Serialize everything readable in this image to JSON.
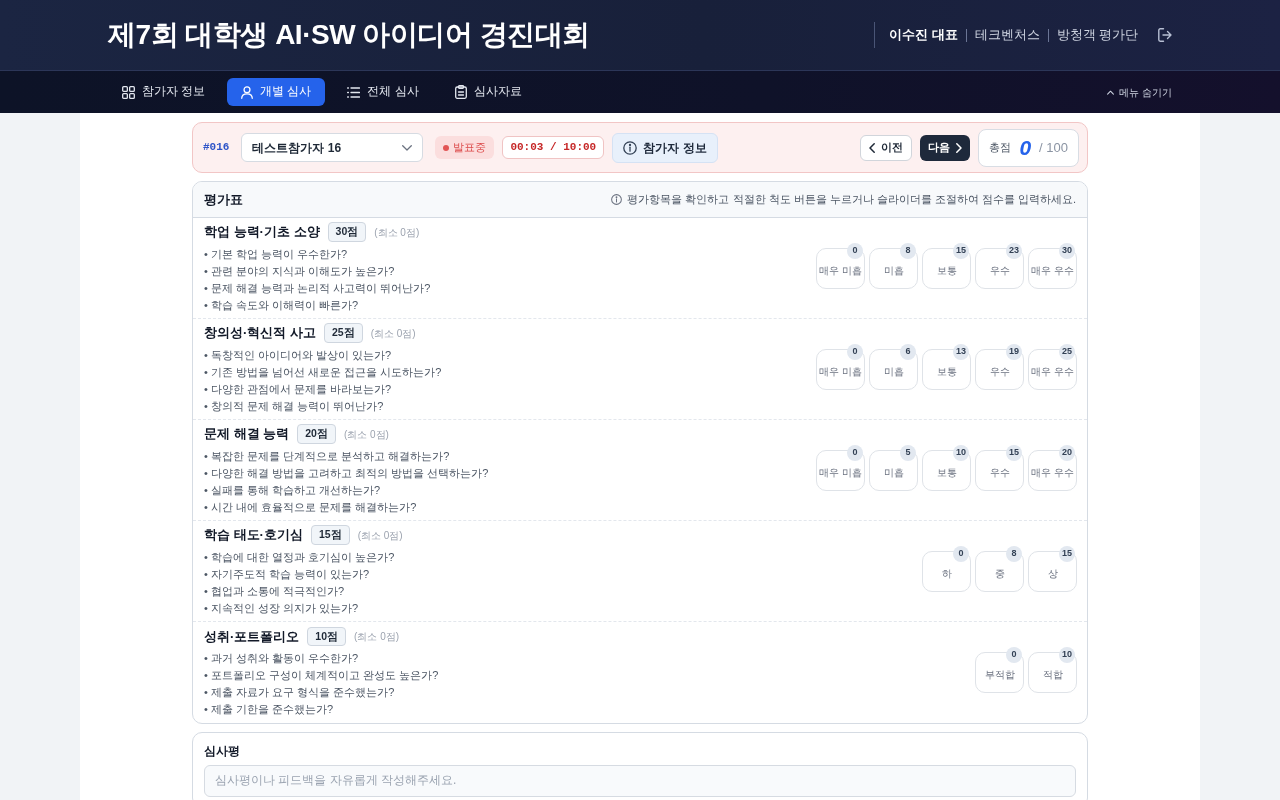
{
  "header": {
    "title": "제7회 대학생 AI·SW 아이디어 경진대회",
    "user": {
      "name": "이수진 대표",
      "company": "테크벤처스",
      "role": "방청객 평가단"
    }
  },
  "nav": {
    "tabs": [
      {
        "label": "참가자 정보",
        "selected": false
      },
      {
        "label": "개별 심사",
        "selected": true
      },
      {
        "label": "전체 심사",
        "selected": false
      },
      {
        "label": "심사자료",
        "selected": false
      }
    ],
    "toggle": "메뉴 숨기기"
  },
  "participant": {
    "number": "#016",
    "name": "테스트참가자 16",
    "status": {
      "kind": "live",
      "label": "발표중"
    },
    "timer": "00:03 / 10:00",
    "info_button": "참가자 정보",
    "prev": "이전",
    "next": "다음",
    "total": {
      "label": "총점",
      "score": "0",
      "max": "/ 100"
    }
  },
  "evaluation": {
    "title": "평가표",
    "hint": "평가항목을 확인하고 적절한 척도 버튼을 누르거나 슬라이더를 조절하여 점수를 입력하세요.",
    "criteria": [
      {
        "title": "학업 능력·기초 소양",
        "points": "30점",
        "minimum": "(최소 0점)",
        "questions": [
          "• 기본 학업 능력이 우수한가?",
          "• 관련 분야의 지식과 이해도가 높은가?",
          "• 문제 해결 능력과 논리적 사고력이 뛰어난가?",
          "• 학습 속도와 이해력이 빠른가?"
        ],
        "options": [
          {
            "label": "매우 미흡",
            "value": "0",
            "selected": false
          },
          {
            "label": "미흡",
            "value": "8",
            "selected": false
          },
          {
            "label": "보통",
            "value": "15",
            "selected": false
          },
          {
            "label": "우수",
            "value": "23",
            "selected": false
          },
          {
            "label": "매우 우수",
            "value": "30",
            "selected": false
          }
        ]
      },
      {
        "title": "창의성·혁신적 사고",
        "points": "25점",
        "minimum": "(최소 0점)",
        "questions": [
          "• 독창적인 아이디어와 발상이 있는가?",
          "• 기존 방법을 넘어선 새로운 접근을 시도하는가?",
          "• 다양한 관점에서 문제를 바라보는가?",
          "• 창의적 문제 해결 능력이 뛰어난가?"
        ],
        "options": [
          {
            "label": "매우 미흡",
            "value": "0",
            "selected": false
          },
          {
            "label": "미흡",
            "value": "6",
            "selected": false
          },
          {
            "label": "보통",
            "value": "13",
            "selected": false
          },
          {
            "label": "우수",
            "value": "19",
            "selected": false
          },
          {
            "label": "매우 우수",
            "value": "25",
            "selected": false
          }
        ]
      },
      {
        "title": "문제 해결 능력",
        "points": "20점",
        "minimum": "(최소 0점)",
        "questions": [
          "• 복잡한 문제를 단계적으로 분석하고 해결하는가?",
          "• 다양한 해결 방법을 고려하고 최적의 방법을 선택하는가?",
          "• 실패를 통해 학습하고 개선하는가?",
          "• 시간 내에 효율적으로 문제를 해결하는가?"
        ],
        "options": [
          {
            "label": "매우 미흡",
            "value": "0",
            "selected": false
          },
          {
            "label": "미흡",
            "value": "5",
            "selected": false
          },
          {
            "label": "보통",
            "value": "10",
            "selected": false
          },
          {
            "label": "우수",
            "value": "15",
            "selected": false
          },
          {
            "label": "매우 우수",
            "value": "20",
            "selected": false
          }
        ]
      },
      {
        "title": "학습 태도·호기심",
        "points": "15점",
        "minimum": "(최소 0점)",
        "questions": [
          "• 학습에 대한 열정과 호기심이 높은가?",
          "• 자기주도적 학습 능력이 있는가?",
          "• 협업과 소통에 적극적인가?",
          "• 지속적인 성장 의지가 있는가?"
        ],
        "options": [
          {
            "label": "하",
            "value": "0",
            "selected": false
          },
          {
            "label": "중",
            "value": "8",
            "selected": false
          },
          {
            "label": "상",
            "value": "15",
            "selected": false
          }
        ]
      },
      {
        "title": "성취·포트폴리오",
        "points": "10점",
        "minimum": "(최소 0점)",
        "questions": [
          "• 과거 성취와 활동이 우수한가?",
          "• 포트폴리오 구성이 체계적이고 완성도 높은가?",
          "• 제출 자료가 요구 형식을 준수했는가?",
          "• 제출 기한을 준수했는가?"
        ],
        "options": [
          {
            "label": "부적합",
            "value": "0",
            "selected": false
          },
          {
            "label": "적합",
            "value": "10",
            "selected": false
          }
        ]
      }
    ]
  },
  "review": {
    "title": "심사평",
    "placeholder": "심사평이나 피드백을 자유롭게 작성해주세요."
  }
}
